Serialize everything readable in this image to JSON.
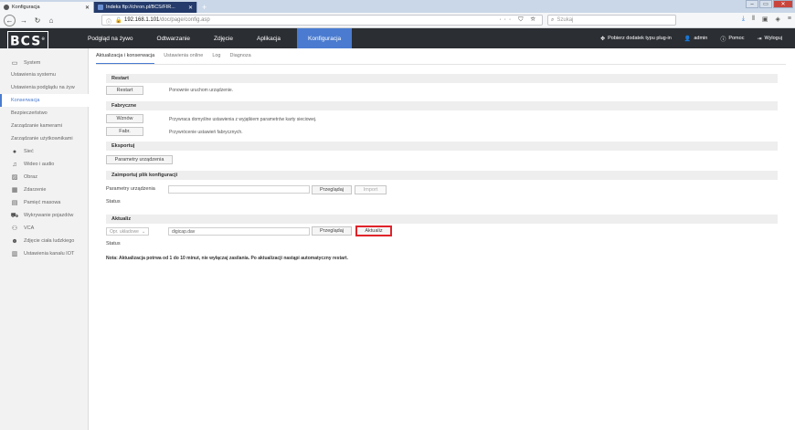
{
  "browser": {
    "tabs": [
      {
        "title": "Konfiguracja",
        "active": true
      },
      {
        "title": "Indeks ftp://chron.pl/BCS/FIR...",
        "active": false
      }
    ],
    "url_host": "192.168.1.101",
    "url_path": "/doc/page/config.asp",
    "search_placeholder": "Szukaj",
    "new_tab": "+"
  },
  "header": {
    "logo": "BCS",
    "nav": [
      "Podgląd na żywo",
      "Odtwarzanie",
      "Zdjęcie",
      "Aplikacja",
      "Konfiguracja"
    ],
    "active_nav": "Konfiguracja",
    "plugin": "Pobierz dodatek typu plug-in",
    "user": "admin",
    "help": "Pomoc",
    "logout": "Wyloguj"
  },
  "sidebar": {
    "system": "System",
    "sub_items": [
      "Ustawienia systemu",
      "Ustawienia podglądu na żyw",
      "Konserwacja",
      "Bezpieczeństwo",
      "Zarządzanie kamerami",
      "Zarządzanie użytkownikami"
    ],
    "active_sub": "Konserwacja",
    "items": [
      {
        "label": "Sieć",
        "icon": "globe-icon"
      },
      {
        "label": "Wideo i audio",
        "icon": "video-audio-icon"
      },
      {
        "label": "Obraz",
        "icon": "image-icon"
      },
      {
        "label": "Zdarzenie",
        "icon": "calendar-icon"
      },
      {
        "label": "Pamięć masowa",
        "icon": "storage-icon"
      },
      {
        "label": "Wykrywanie pojazdów",
        "icon": "vehicle-icon"
      },
      {
        "label": "VCA",
        "icon": "vca-icon"
      },
      {
        "label": "Zdjęcie ciała ludzkiego",
        "icon": "person-icon"
      },
      {
        "label": "Ustawienia kanału IOT",
        "icon": "iot-icon"
      }
    ]
  },
  "subtabs": [
    "Aktualizacja i konserwacja",
    "Ustawienia online",
    "Log",
    "Diagnoza"
  ],
  "active_subtab": "Aktualizacja i konserwacja",
  "restart": {
    "title": "Restart",
    "button": "Restart",
    "desc": "Ponownie uruchom urządzenie."
  },
  "factory": {
    "title": "Fabryczne",
    "restore_button": "Wznów",
    "restore_desc": "Przywraca domyślne ustawienia z wyjątkiem parametrów karty sieciowej.",
    "default_button": "Fabr.",
    "default_desc": "Przywrócenie ustawień fabrycznych."
  },
  "export": {
    "title": "Eksportuj",
    "button": "Parametry urządzenia"
  },
  "import": {
    "title": "Zaimportuj plik konfiguracji",
    "label": "Parametry urządzenia",
    "value": "",
    "browse": "Przeglądaj",
    "import_button": "Import",
    "status": "Status"
  },
  "upgrade": {
    "title": "Aktualiz",
    "select": "Opr. układowe",
    "file": "digicap.dav",
    "browse": "Przeglądaj",
    "button": "Aktualiz",
    "status": "Status"
  },
  "note": "Nota: Aktualizacja potrwa od 1 do 10 minut, nie wyłączaj zasilania. Po aktualizacji nastąpi automatyczny restart."
}
